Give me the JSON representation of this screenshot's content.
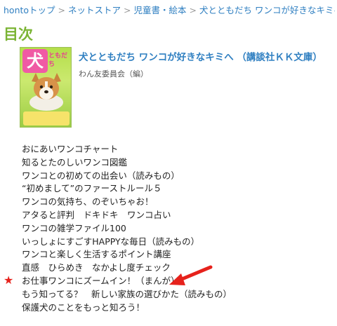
{
  "breadcrumb": {
    "items": [
      "hontoトップ",
      "ネットストア",
      "児童書・絵本",
      "犬とともだち ワンコが好きなキミへ"
    ],
    "separator": ">"
  },
  "page_title": "目次",
  "book": {
    "title": "犬とともだち ワンコが好きなキミへ （講談社ＫＫ文庫）",
    "author": "わん友委員会（編）",
    "cover_title": "犬",
    "cover_subtitle": "ともだち"
  },
  "toc": {
    "items": [
      "おにあいワンコチャート",
      "知るとたのしいワンコ図鑑",
      "ワンコとの初めての出会い（読みもの）",
      "“初めまして”のファーストルール５",
      "ワンコの気持ち、のぞいちゃお！",
      "アタると評判　ドキドキ　ワンコ占い",
      "ワンコの雑学ファイル100",
      "いっしょにすごすHAPPYな毎日（読みもの）",
      "ワンコと楽しく生活するポイント講座",
      "直感　ひらめき　なかよし度チェック",
      "お仕事ワンコにズームイン！（まんが）",
      "もう知ってる？　新しい家族の選びかた（読みもの）",
      "保護犬のことをもっと知ろう！"
    ],
    "marked_item": "お仕事ワンコにズームイン！（まんが）"
  },
  "annotations": {
    "star_glyph": "★",
    "star_color": "#e6221c",
    "arrow_color": "#e6221c",
    "arrow_icon": "arrow-pointing-left-icon"
  },
  "colors": {
    "link": "#2f7fc1",
    "heading": "#7bb434"
  }
}
